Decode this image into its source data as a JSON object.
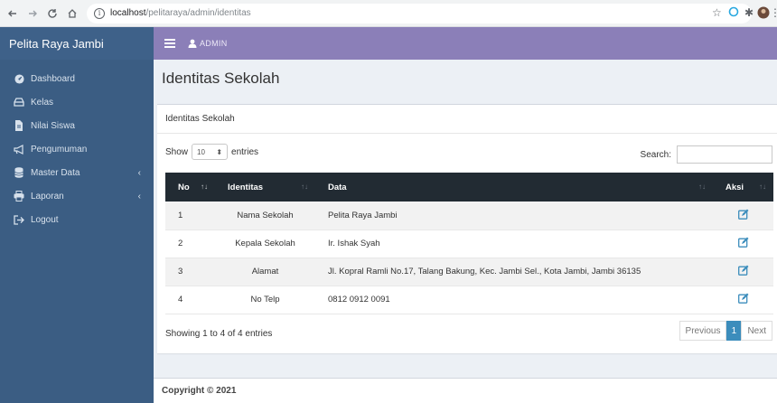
{
  "browser": {
    "url_host": "localhost",
    "url_path": "/pelitaraya/admin/identitas",
    "info_glyph": "i"
  },
  "sidebar": {
    "brand": "Pelita Raya Jambi",
    "items": [
      {
        "label": "Dashboard",
        "icon": "dashboard-icon"
      },
      {
        "label": "Kelas",
        "icon": "class-icon"
      },
      {
        "label": "Nilai Siswa",
        "icon": "file-icon"
      },
      {
        "label": "Pengumuman",
        "icon": "megaphone-icon"
      },
      {
        "label": "Master Data",
        "icon": "database-icon",
        "has_children": true
      },
      {
        "label": "Laporan",
        "icon": "print-icon",
        "has_children": true
      },
      {
        "label": "Logout",
        "icon": "logout-icon"
      }
    ]
  },
  "navbar": {
    "user_label": "ADMIN",
    "background": "#8b7fb8"
  },
  "page": {
    "title": "Identitas Sekolah"
  },
  "box": {
    "header": "Identitas Sekolah",
    "show_label": "Show",
    "entries_value": "10",
    "entries_label": "entries",
    "search_label": "Search:",
    "search_value": ""
  },
  "table": {
    "columns": [
      "No",
      "Identitas",
      "Data",
      "Aksi"
    ],
    "rows": [
      {
        "no": "1",
        "identitas": "Nama Sekolah",
        "data": "Pelita Raya Jambi"
      },
      {
        "no": "2",
        "identitas": "Kepala Sekolah",
        "data": "Ir. Ishak Syah"
      },
      {
        "no": "3",
        "identitas": "Alamat",
        "data": "Jl. Kopral Ramli No.17, Talang Bakung, Kec. Jambi Sel., Kota Jambi, Jambi 36135"
      },
      {
        "no": "4",
        "identitas": "No Telp",
        "data": "0812 0912 0091"
      }
    ]
  },
  "pagination": {
    "info": "Showing 1 to 4 of 4 entries",
    "previous": "Previous",
    "current": "1",
    "next": "Next"
  },
  "footer": {
    "copyright": "Copyright © 2021"
  },
  "colors": {
    "sidebar": "#3b5d83",
    "table_header": "#222b33",
    "accent": "#3c8dbc"
  }
}
